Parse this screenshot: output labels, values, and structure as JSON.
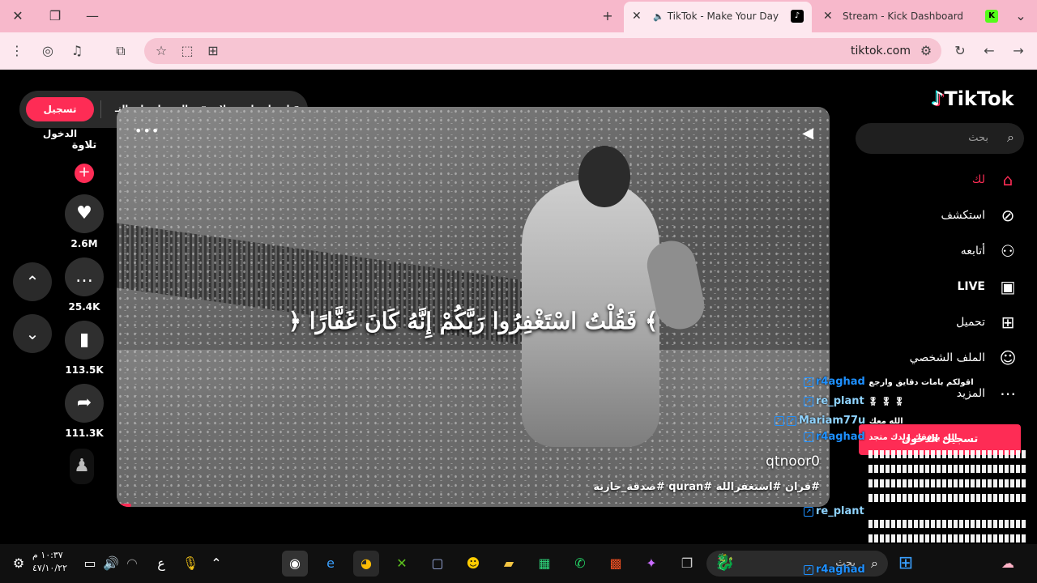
{
  "browser": {
    "tabs": [
      {
        "title": "TikTok - Make Your Day",
        "favicon": "tiktok-favicon",
        "active": true
      },
      {
        "title": "Stream - Kick Dashboard",
        "favicon": "kick-favicon",
        "active": false
      }
    ],
    "new_tab": "+",
    "url": "tiktok.com",
    "colors": {
      "tabbar": "#f7b8cb",
      "toolbar": "#fde8ef"
    }
  },
  "topbar": {
    "login": "تسجيل الدخول",
    "get_app": "الحصول على التـ...",
    "get_coins": "احصل على عملات"
  },
  "video": {
    "verse": "﴿ فَقُلْتُ اسْتَغْفِرُوا رَبَّكُمْ إِنَّهُ كَانَ غَفَّارًا ﴾",
    "username": "qtnoor0",
    "hashtags": "#قران #استغفرالله #quran #صدقة_جارية",
    "progress": 0.02
  },
  "actions": {
    "account": "تلاوة",
    "likes": "2.6M",
    "comments": "25.4K",
    "saves": "113.5K",
    "shares": "111.3K"
  },
  "sidebar": {
    "logo": "TikTok",
    "search_placeholder": "بحث",
    "items": [
      {
        "label": "لك",
        "icon": "home-icon",
        "active": true
      },
      {
        "label": "استكشف",
        "icon": "compass-icon",
        "active": false
      },
      {
        "label": "أتابعه",
        "icon": "following-icon",
        "active": false
      },
      {
        "label": "LIVE",
        "icon": "live-icon",
        "active": false
      },
      {
        "label": "تحميل",
        "icon": "upload-icon",
        "active": false
      },
      {
        "label": "الملف الشخصي",
        "icon": "profile-icon",
        "active": false
      },
      {
        "label": "المزيد",
        "icon": "more-icon",
        "active": false
      }
    ],
    "login_button": "تسجيل الدخول"
  },
  "chat": [
    {
      "name": "r4aghad",
      "message": "اقولكم بامات دقايق وارجع"
    },
    {
      "name": "re_plant",
      "message": "🎖 🎖 🎖"
    },
    {
      "name": "Mariam77u",
      "message": "الله معك"
    },
    {
      "name": "r4aghad",
      "message": "الله يوفقك ولدك متجد"
    },
    {
      "name": "re_plant",
      "message": ""
    },
    {
      "name": "r4aghad",
      "message": ""
    }
  ],
  "taskbar": {
    "time": "١٠:٣٧ م",
    "date": "٤٧/١٠/٢٢",
    "lang": "ع",
    "search_placeholder": "بحث"
  }
}
